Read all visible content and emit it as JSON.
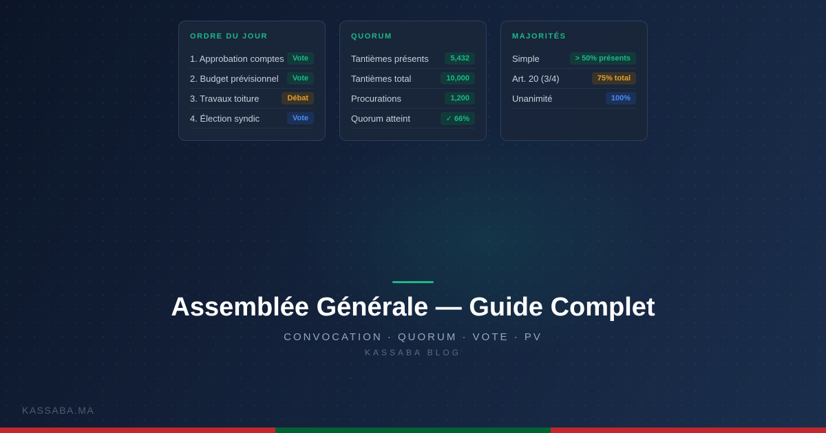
{
  "cards": [
    {
      "title": "ORDRE DU JOUR",
      "rows": [
        {
          "label": "1. Approbation comptes",
          "badge": "Vote",
          "badge_color": "green"
        },
        {
          "label": "2. Budget prévisionnel",
          "badge": "Vote",
          "badge_color": "green"
        },
        {
          "label": "3. Travaux toiture",
          "badge": "Débat",
          "badge_color": "orange"
        },
        {
          "label": "4. Élection syndic",
          "badge": "Vote",
          "badge_color": "blue"
        }
      ]
    },
    {
      "title": "QUORUM",
      "rows": [
        {
          "label": "Tantièmes présents",
          "badge": "5,432",
          "badge_color": "green"
        },
        {
          "label": "Tantièmes total",
          "badge": "10,000",
          "badge_color": "green"
        },
        {
          "label": "Procurations",
          "badge": "1,200",
          "badge_color": "green"
        },
        {
          "label": "Quorum atteint",
          "badge": "✓ 66%",
          "badge_color": "green"
        }
      ]
    },
    {
      "title": "MAJORITÉS",
      "rows": [
        {
          "label": "Simple",
          "badge": "> 50% présents",
          "badge_color": "green"
        },
        {
          "label": "Art. 20 (3/4)",
          "badge": "75% total",
          "badge_color": "orange"
        },
        {
          "label": "Unanimité",
          "badge": "100%",
          "badge_color": "blue"
        }
      ]
    }
  ],
  "hero": {
    "title": "Assemblée Générale — Guide Complet",
    "subtitle": "CONVOCATION · QUORUM · VOTE · PV",
    "source": "KASSABA BLOG"
  },
  "footer": {
    "site": "KASSABA.MA",
    "flag_colors": [
      "#c1272d",
      "#006233",
      "#c1272d"
    ]
  },
  "colors": {
    "accent": "#1db888",
    "badge_green": "#1db888",
    "badge_orange": "#e0a030",
    "badge_blue": "#4a8cf0"
  }
}
